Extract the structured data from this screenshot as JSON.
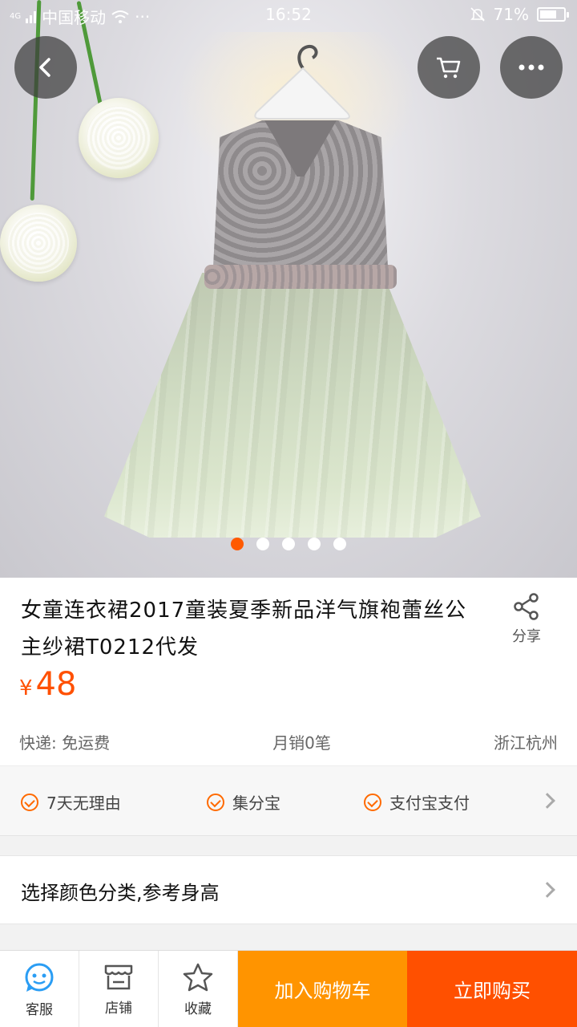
{
  "status_bar": {
    "network": "4G",
    "carrier": "中国移动",
    "more": "···",
    "time": "16:52",
    "battery": "71%",
    "battery_level": 0.71
  },
  "gallery": {
    "total_images": 5,
    "active_index": 0
  },
  "product": {
    "title": "女童连衣裙2017童装夏季新品洋气旗袍蕾丝公主纱裙T0212代发",
    "share_label": "分享",
    "currency": "¥",
    "price": "48",
    "shipping": "快递: 免运费",
    "monthly_sales": "月销0笔",
    "location": "浙江杭州"
  },
  "guarantees": [
    "7天无理由",
    "集分宝",
    "支付宝支付"
  ],
  "option_select": "选择颜色分类,参考身高",
  "bottom_bar": {
    "service": "客服",
    "store": "店铺",
    "favorite": "收藏",
    "add_to_cart": "加入购物车",
    "buy_now": "立即购买"
  },
  "colors": {
    "accent": "#ff5000",
    "cart_button": "#ff9400",
    "buy_button": "#ff5000",
    "service_icon": "#2a9df4"
  }
}
